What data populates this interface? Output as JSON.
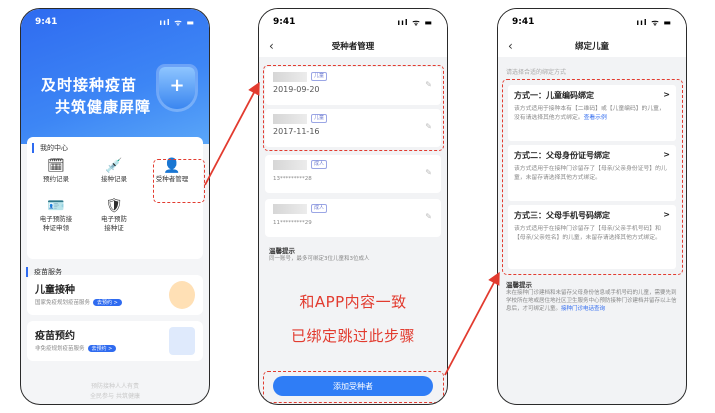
{
  "phone1": {
    "time": "9:41",
    "signal": "ııl ᯤ ▬",
    "hero_line1": "及时接种疫苗",
    "hero_line2": "共筑健康屏障",
    "my_center": "我的中心",
    "grid": [
      {
        "icon": "🗓",
        "label": "预约记录"
      },
      {
        "icon": "💉",
        "label": "接种记录"
      },
      {
        "icon": "👤",
        "label": "受种者管理"
      },
      {
        "icon": "🪪",
        "label": "电子预防接\n种证申领"
      },
      {
        "icon": "🛡",
        "label": "电子预防\n接种证"
      }
    ],
    "vaccine_service": "疫苗服务",
    "services": [
      {
        "title": "儿童接种",
        "sub": "国家免疫规划疫苗服务",
        "btn": "去预约 >"
      },
      {
        "title": "疫苗预约",
        "sub": "非免疫规划疫苗服务",
        "btn": "去预约 >"
      }
    ],
    "footer1": "预防接种人人有责",
    "footer2": "全民参与 共筑健康"
  },
  "phone2": {
    "time": "9:41",
    "signal": "ııl ᯤ ▬",
    "title": "受种者管理",
    "persons": [
      {
        "tag": "儿童",
        "sub": "2019-09-20"
      },
      {
        "tag": "儿童",
        "sub": "2017-11-16"
      },
      {
        "tag": "成人",
        "sub": "13*********28"
      },
      {
        "tag": "成人",
        "sub": "11*********29"
      }
    ],
    "tip_title": "温馨提示",
    "tip_text": "同一账号，最多可绑定3位儿童和3位成人",
    "anno1": "和APP内容一致",
    "anno2": "已绑定跳过此步骤",
    "add_button": "添加受种者"
  },
  "phone3": {
    "time": "9:41",
    "signal": "ııl ᯤ ▬",
    "title": "绑定儿童",
    "hint": "请选择合适的绑定方式",
    "methods": [
      {
        "title": "方式一：儿童编码绑定",
        "desc": "该方式适用于接种本有【二维码】或【儿童编码】的儿童，没有请选择其他方式绑定。",
        "link": "查看示例"
      },
      {
        "title": "方式二：父母身份证号绑定",
        "desc": "该方式适用于在接种门诊留存了【母亲/父亲身份证号】的儿童，未留存请选择其他方式绑定。",
        "link": ""
      },
      {
        "title": "方式三：父母手机号码绑定",
        "desc": "该方式适用于在接种门诊留存了【母亲/父亲手机号码】和【母亲/父亲姓名】的儿童，未留存请选择其他方式绑定。",
        "link": ""
      }
    ],
    "tip_title": "温馨提示",
    "tip_text": "未在接种门诊建档和未留存父母身份信息或手机号码的儿童，需要先到学校所在地或居住地社区卫生服务中心预防接种门诊建档并留存以上信息后，才可绑定儿童。",
    "tip_link": "接种门诊电话查询"
  },
  "colors": {
    "accent": "#2f6bf0",
    "annotation": "#e23b2f"
  }
}
